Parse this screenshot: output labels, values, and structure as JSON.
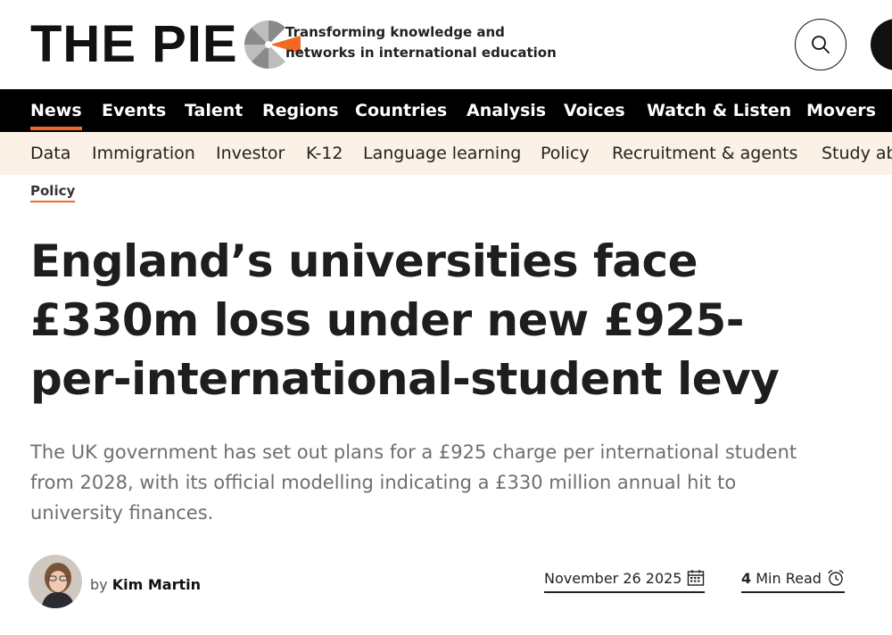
{
  "brand": {
    "logo_text": "THE PIE",
    "tagline_line1": "Transforming knowledge and",
    "tagline_line2": "networks in international education",
    "accent_color": "#f26a21"
  },
  "header": {
    "search_icon": "search-icon",
    "menu_icon": "menu-icon"
  },
  "nav_primary": {
    "active": "News",
    "items": [
      "News",
      "Events",
      "Talent",
      "Regions",
      "Countries",
      "Analysis",
      "Voices",
      "Watch & Listen",
      "Movers"
    ]
  },
  "nav_secondary": {
    "items": [
      "Data",
      "Immigration",
      "Investor",
      "K-12",
      "Language learning",
      "Policy",
      "Recruitment & agents",
      "Study ab"
    ]
  },
  "article": {
    "category": "Policy",
    "headline_line1": "England’s universities face",
    "headline_line2": "£330m loss under new £925-",
    "headline_line3": "per-international-student levy",
    "standfirst_line1": "The UK government has set out plans for a £925 charge per international student",
    "standfirst_line2": "from 2028, with its official modelling indicating a £330 million annual hit to",
    "standfirst_line3": "university finances.",
    "byline_prefix": "by",
    "author": "Kim Martin",
    "date": "November 26 2025",
    "read_minutes": "4",
    "read_label": "Min Read"
  }
}
